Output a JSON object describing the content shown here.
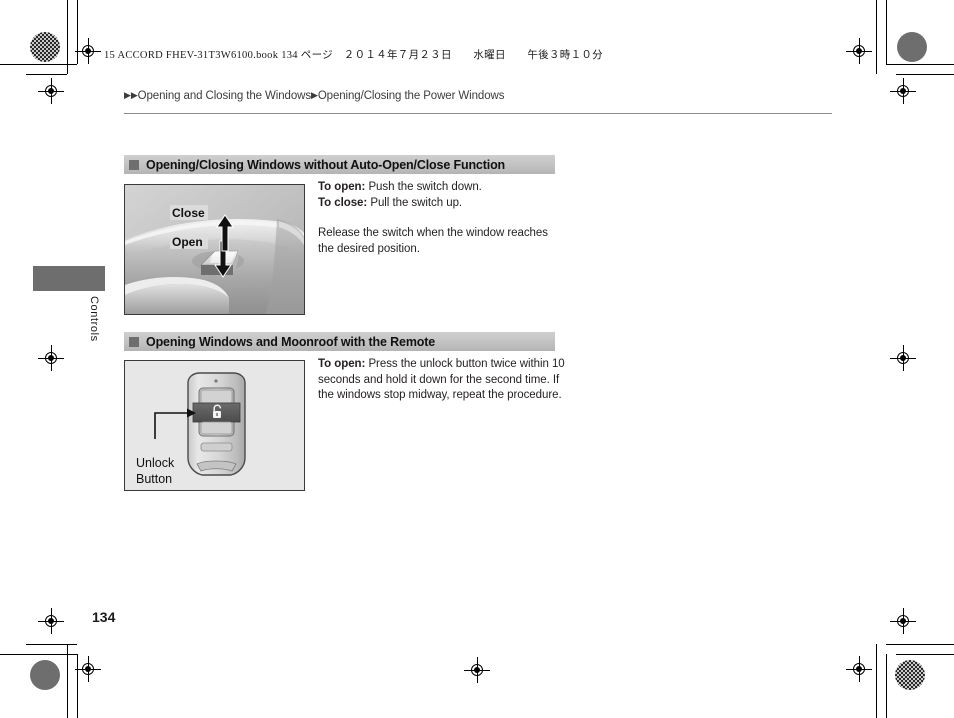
{
  "book_header": {
    "prefix": "15 ACCORD FHEV-31T3W6100.book",
    "page_label": "134 ページ",
    "date": "２０１４年７月２３日",
    "weekday": "水曜日",
    "time": "午後３時１０分",
    "full": "15 ACCORD FHEV-31T3W6100.book   134 ページ　２０１４年７月２３日　　水曜日　　午後３時１０分"
  },
  "breadcrumb": {
    "marker": "▶▶",
    "level1": "Opening and Closing the Windows",
    "separator": "▶",
    "level2": "Opening/Closing the Power Windows"
  },
  "side_tab": {
    "label": "Controls"
  },
  "sections": [
    {
      "heading": "Opening/Closing Windows without Auto-Open/Close Function",
      "figure": {
        "name": "power-window-switch-illustration",
        "caption_up": "Close",
        "caption_down": "Open"
      },
      "text": {
        "line1_label": "To open:",
        "line1_body": " Push the switch down.",
        "line2_label": "To close:",
        "line2_body": " Pull the switch up.",
        "para2": "Release the switch when the window reaches the desired position."
      }
    },
    {
      "heading": "Opening Windows and Moonroof with the Remote",
      "figure": {
        "name": "remote-transmitter-illustration",
        "callout_line1": "Unlock",
        "callout_line2": "Button"
      },
      "text": {
        "line1_label": "To open:",
        "line1_body": " Press the unlock button twice within 10 seconds and hold it down for the second time. If the windows stop midway, repeat the procedure."
      }
    }
  ],
  "page_number": "134",
  "colors": {
    "heading_bar": "#c2c2c2",
    "heading_bullet": "#6e6e6e",
    "side_tab": "#6e6e6e",
    "rule": "#8c8c8c",
    "text": "#231f20"
  }
}
